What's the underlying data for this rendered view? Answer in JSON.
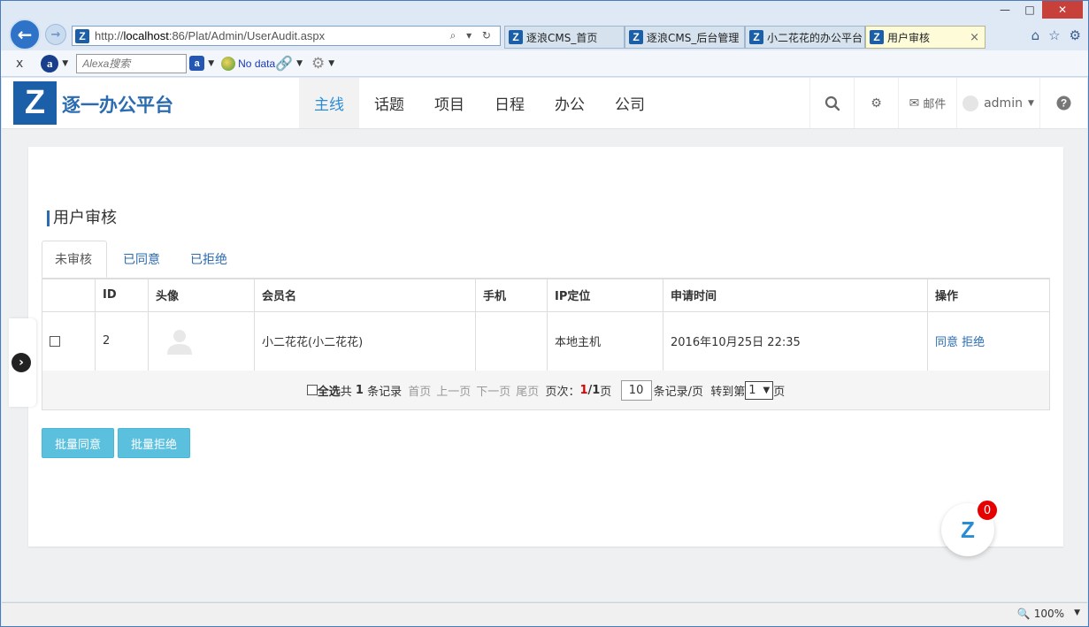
{
  "browser": {
    "url_prefix": "http://",
    "url_host": "localhost",
    "url_rest": ":86/Plat/Admin/UserAudit.aspx",
    "addr_tools": "⌕ ▾ ↻",
    "tabs": [
      {
        "label": "逐浪CMS_首页"
      },
      {
        "label": "逐浪CMS_后台管理"
      },
      {
        "label": "小二花花的办公平台"
      },
      {
        "label": "用户审核"
      }
    ],
    "tab_close": "×",
    "win_min": "—",
    "win_max": "□",
    "win_close": "✕",
    "toolbar": {
      "close": "x",
      "alexa_placeholder": "Alexa搜索",
      "nodata": "No data"
    },
    "zoom": "100%"
  },
  "site": {
    "logo_letter": "Z",
    "name": "逐一办公平台",
    "nav": [
      {
        "label": "主线",
        "active": true
      },
      {
        "label": "话题"
      },
      {
        "label": "项目"
      },
      {
        "label": "日程"
      },
      {
        "label": "办公"
      },
      {
        "label": "公司"
      }
    ],
    "mail_label": "邮件",
    "user": "admin"
  },
  "page": {
    "title": "用户审核",
    "tabs": [
      {
        "label": "未审核",
        "active": true
      },
      {
        "label": "已同意"
      },
      {
        "label": "已拒绝"
      }
    ],
    "columns": [
      "",
      "ID",
      "头像",
      "会员名",
      "手机",
      "IP定位",
      "申请时间",
      "操作"
    ],
    "rows": [
      {
        "id": "2",
        "username": "小二花花(小二花花)",
        "phone": "",
        "ip": "本地主机",
        "time": "2016年10月25日 22:35",
        "agree": "同意",
        "reject": "拒绝"
      }
    ],
    "pager": {
      "select_all": "全选",
      "total_pre": "共",
      "total": "1",
      "total_post": "条记录",
      "first": "首页",
      "prev": "上一页",
      "next": "下一页",
      "last": "尾页",
      "page_label": "页次：",
      "current": "1",
      "slash": "/",
      "pages": "1",
      "page_suffix": "页",
      "per_page": "10",
      "per_page_label": "条记录/页",
      "goto_label": "转到第",
      "goto_value": "1",
      "goto_suffix": "页"
    },
    "batch_agree": "批量同意",
    "batch_reject": "批量拒绝",
    "chat_badge": "0",
    "chat_letter": "Z"
  }
}
